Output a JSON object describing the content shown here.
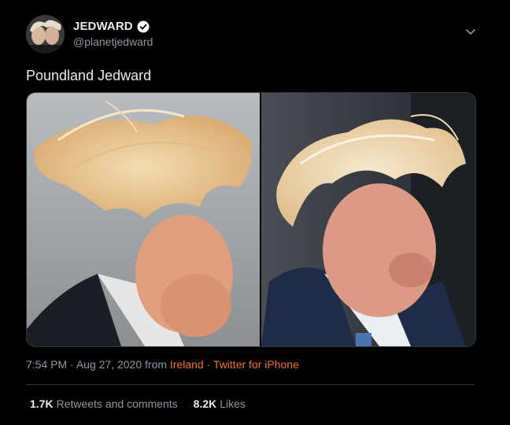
{
  "author": {
    "name": "JEDWARD",
    "handle": "@planetjedward",
    "verified": true
  },
  "tweet": {
    "text": "Poundland Jedward"
  },
  "meta": {
    "time": "7:54 PM",
    "separator": "·",
    "date": "Aug 27, 2020",
    "from_label": "from",
    "location": "Ireland",
    "source": "Twitter for iPhone"
  },
  "stats": {
    "retweets_count": "1.7K",
    "retweets_label": "Retweets and comments",
    "likes_count": "8.2K",
    "likes_label": "Likes"
  },
  "colors": {
    "background": "#000000",
    "link": "#f4731c",
    "verified": "#ffffff"
  },
  "icons": [
    "verified-badge-icon",
    "chevron-down-icon"
  ]
}
